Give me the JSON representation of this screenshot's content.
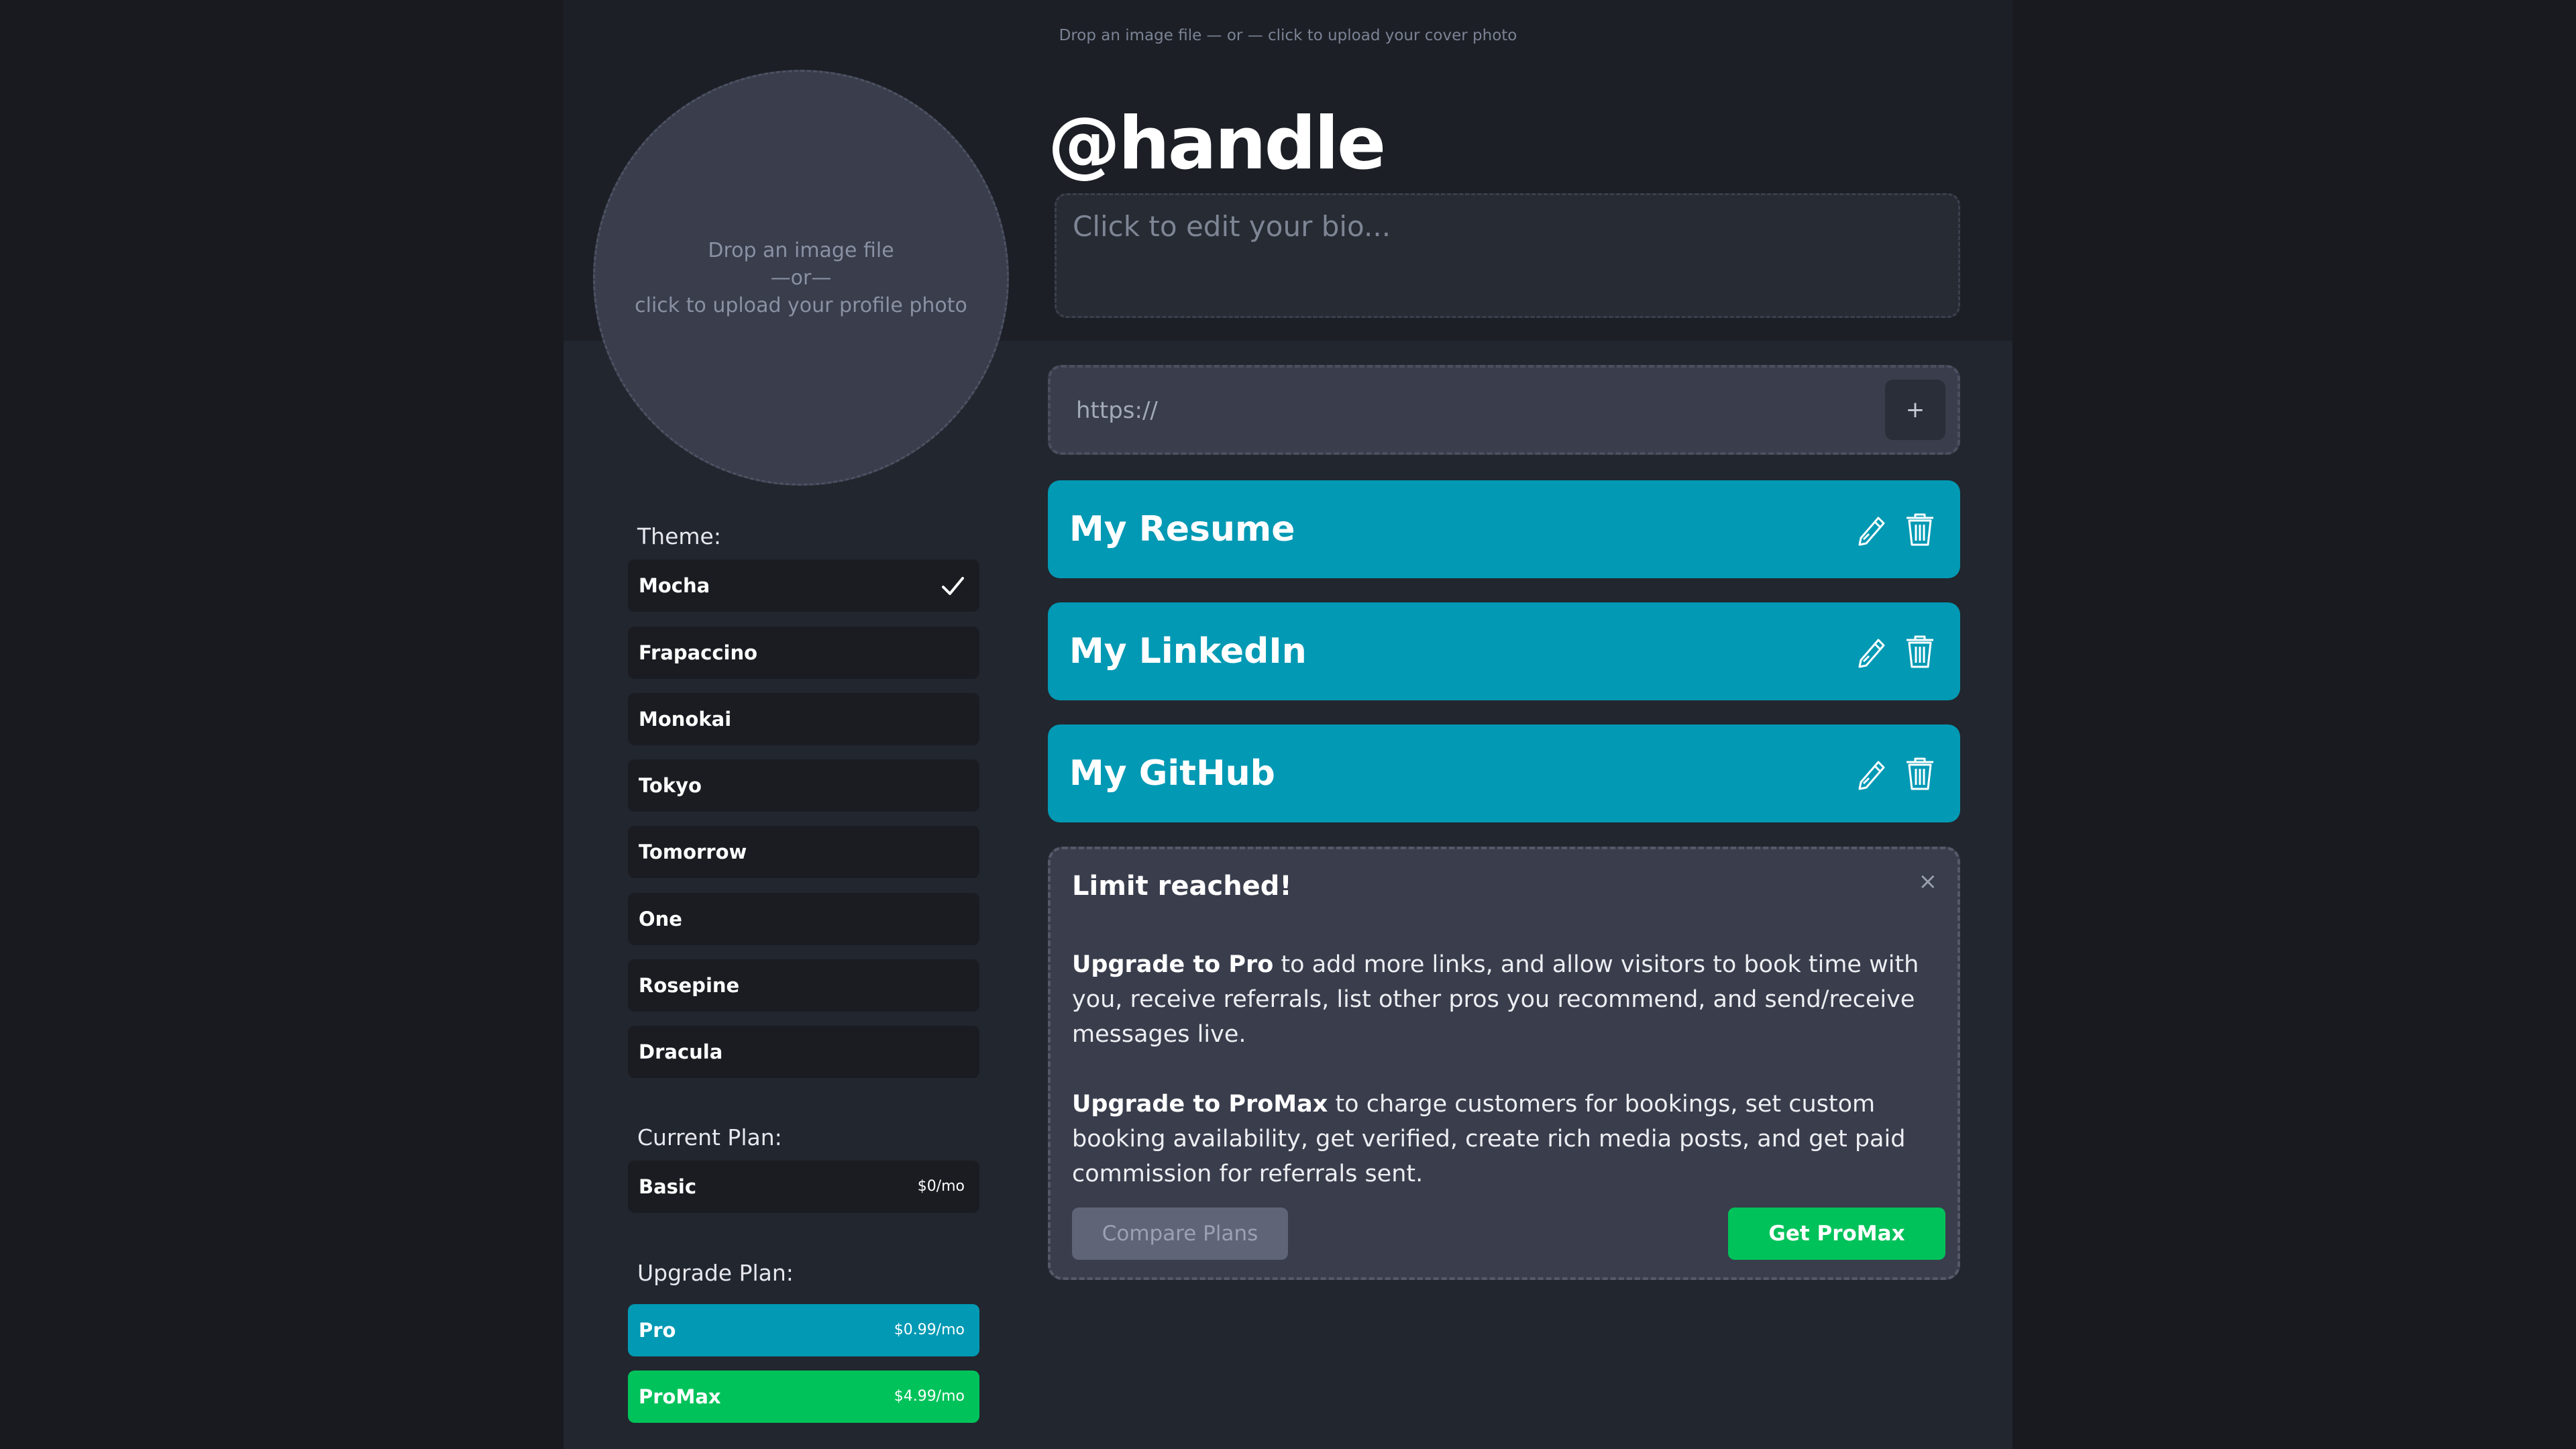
{
  "cover": {
    "hint": "Drop an image file — or — click to upload your cover photo"
  },
  "profile_photo": {
    "line1": "Drop an image file",
    "line2": "—or—",
    "line3": "click to upload your profile photo"
  },
  "profile": {
    "handle": "@handle",
    "bio_placeholder": "Click to edit your bio..."
  },
  "link_input": {
    "placeholder": "https://",
    "add_label": "+"
  },
  "links": [
    {
      "title": "My Resume"
    },
    {
      "title": "My LinkedIn"
    },
    {
      "title": "My GitHub"
    }
  ],
  "limit_notice": {
    "title": "Limit reached!",
    "close_label": "×",
    "pro_lead": "Upgrade to Pro",
    "pro_text": " to add more links, and allow visitors to book time with you, receive referrals, list other pros you recommend, and send/receive messages live.",
    "promax_lead": "Upgrade to ProMax",
    "promax_text": " to charge customers for bookings, set custom booking availability, get verified, create rich media posts, and get paid commission for referrals sent.",
    "compare_label": "Compare Plans",
    "get_promax_label": "Get ProMax"
  },
  "theme": {
    "label": "Theme:",
    "selected": "Mocha",
    "options": [
      "Mocha",
      "Frapaccino",
      "Monokai",
      "Tokyo",
      "Tomorrow",
      "One",
      "Rosepine",
      "Dracula"
    ]
  },
  "current_plan": {
    "label": "Current Plan:",
    "name": "Basic",
    "price": "$0/mo"
  },
  "upgrade_plan": {
    "label": "Upgrade Plan:",
    "pro": {
      "name": "Pro",
      "price": "$0.99/mo"
    },
    "promax": {
      "name": "ProMax",
      "price": "$4.99/mo"
    }
  },
  "colors": {
    "link_card": "#0199b4",
    "promax_green": "#00c25a",
    "panel_bg": "#22262e",
    "page_bg": "#181a20"
  },
  "icons": {
    "edit": "pencil-icon",
    "delete": "trash-icon",
    "selected": "checkmark-icon"
  }
}
